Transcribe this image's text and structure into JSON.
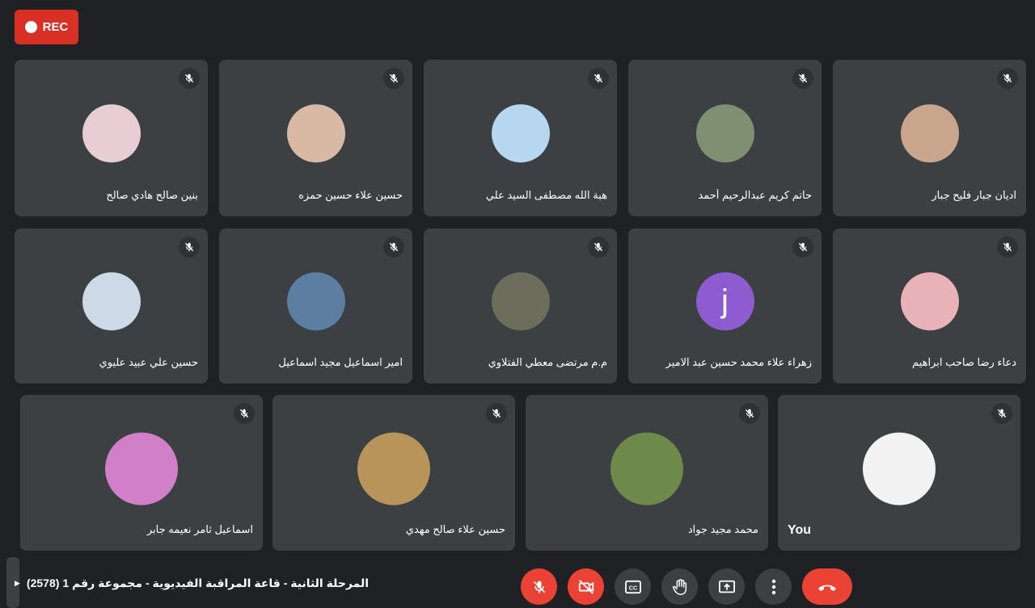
{
  "recording": {
    "label": "REC",
    "color": "#d93025"
  },
  "participants_row1": [
    {
      "name": "بنين صالح هادي صالح",
      "avatar": "photo",
      "color": "#e9cdd4"
    },
    {
      "name": "حسين علاء حسين حمزه",
      "avatar": "photo",
      "color": "#d7b9a6"
    },
    {
      "name": "هبة الله مصطفى السيد علي",
      "avatar": "photo",
      "color": "#b7d6f0"
    },
    {
      "name": "حاتم كريم عبدالرحيم أحمد",
      "avatar": "photo",
      "color": "#7f8f72"
    },
    {
      "name": "اديان جبار فليح جبار",
      "avatar": "photo",
      "color": "#c9a58c"
    }
  ],
  "participants_row2": [
    {
      "name": "حسين علي عبيد عليوي",
      "avatar": "photo",
      "color": "#cdd9e6"
    },
    {
      "name": "امير اسماعيل مجيد اسماعيل",
      "avatar": "photo",
      "color": "#5c7ea1"
    },
    {
      "name": "م.م مرتضى معطي الفتلاوي",
      "avatar": "photo",
      "color": "#6d6d5c"
    },
    {
      "name": "زهراء علاء محمد حسين عبد الامير",
      "avatar": "letter",
      "letter": "j",
      "color": "#8e5bd0"
    },
    {
      "name": "دعاء رضا صاحب ابراهيم",
      "avatar": "photo",
      "color": "#e8b2b9"
    }
  ],
  "participants_row3": [
    {
      "name": "اسماعيل ثامر نعيمه جابر",
      "avatar": "photo",
      "color": "#d07fc8"
    },
    {
      "name": "حسين علاء صالح مهدي",
      "avatar": "photo",
      "color": "#b8945a"
    },
    {
      "name": "محمد مجيد جواد",
      "avatar": "photo",
      "color": "#6e8a4a"
    },
    {
      "name": "You",
      "avatar": "photo",
      "color": "#f2f2f2"
    }
  ],
  "meeting": {
    "title": "المرحلة الثانية - قاعة المراقبة الفيديوية - مجموعة رقم 1 (2578)"
  },
  "controls": [
    {
      "icon": "mic-off-icon"
    },
    {
      "icon": "camera-off-icon"
    },
    {
      "icon": "captions-icon",
      "label": "CC"
    },
    {
      "icon": "raise-hand-icon"
    },
    {
      "icon": "present-screen-icon"
    },
    {
      "icon": "more-options-icon"
    },
    {
      "icon": "end-call-icon"
    }
  ]
}
